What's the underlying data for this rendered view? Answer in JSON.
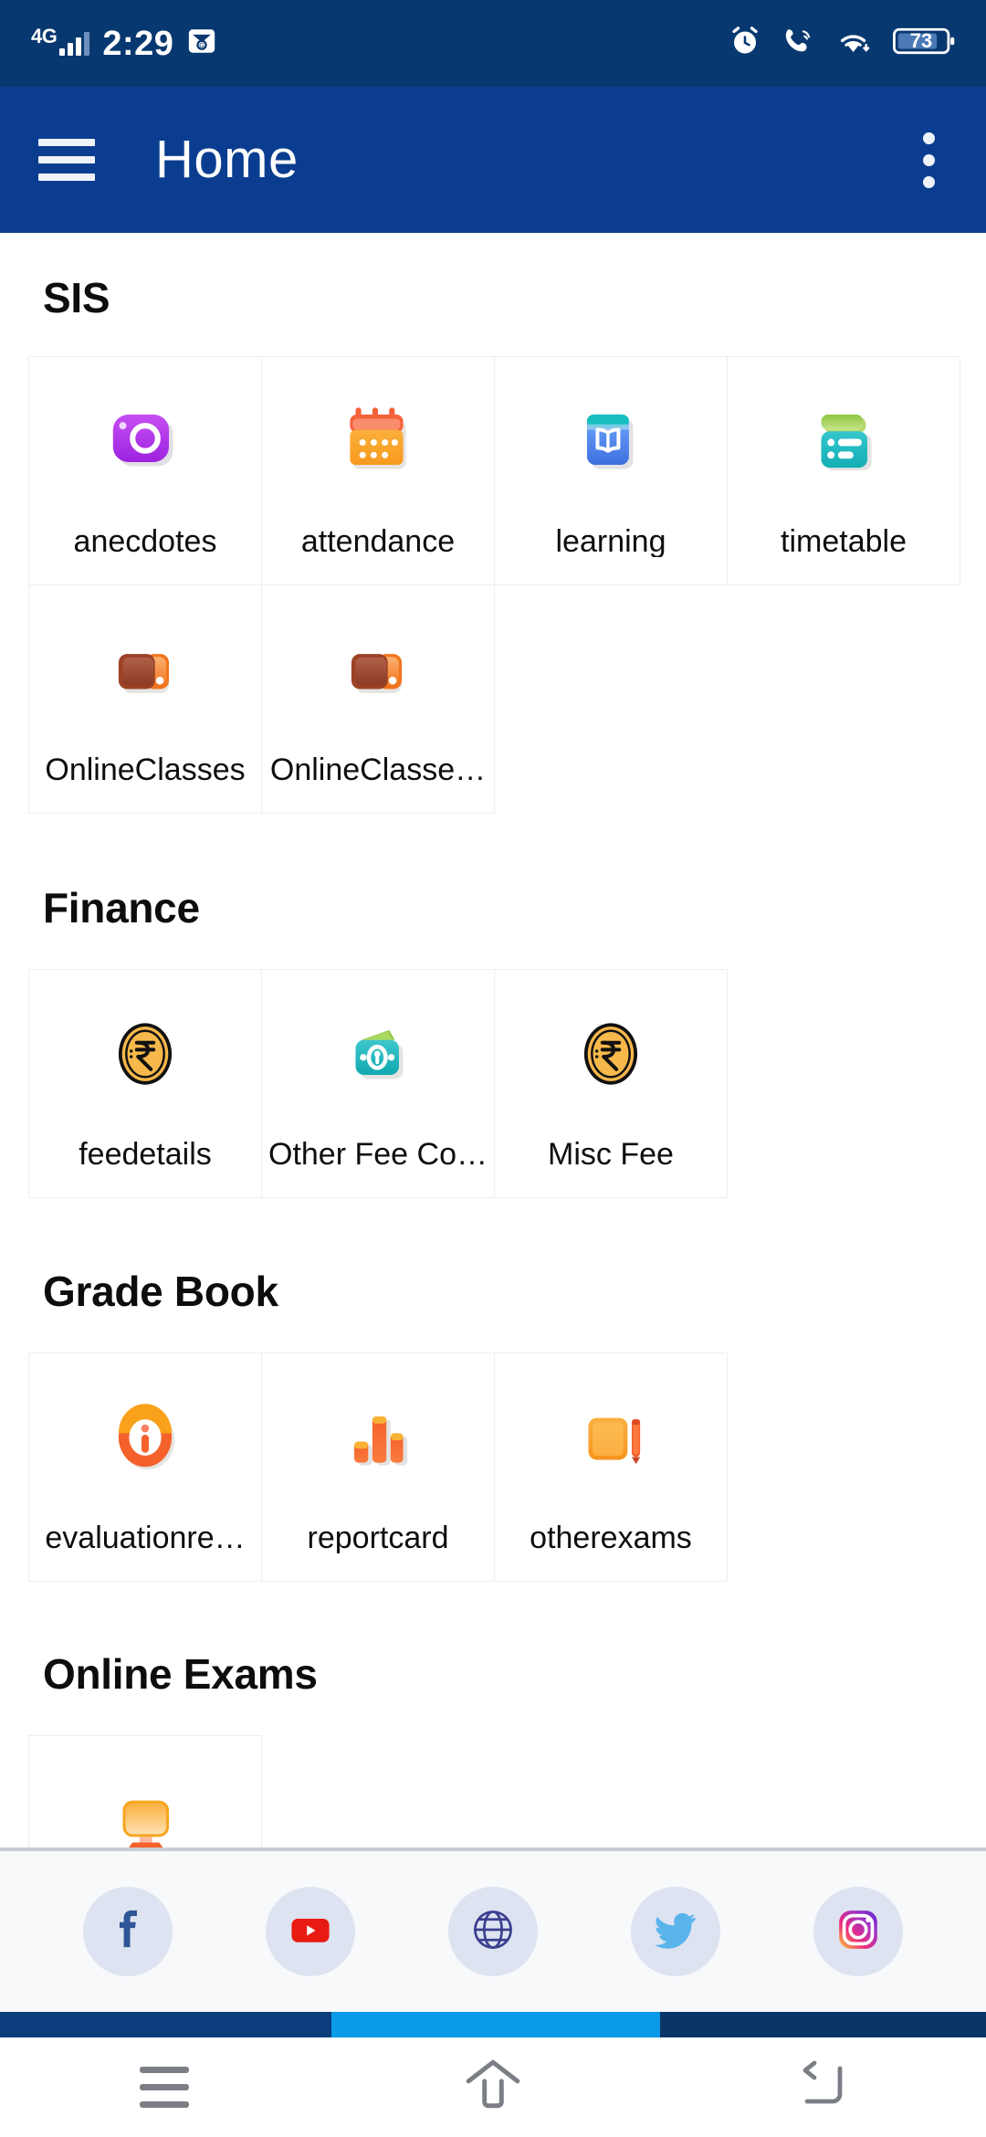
{
  "status_bar": {
    "network": "4G",
    "time": "2:29",
    "mail_icon": "mail-icon",
    "alarm_icon": "alarm-icon",
    "wifi_calling_icon": "wifi-calling-icon",
    "wifi_icon": "wifi-icon",
    "battery_level": "73"
  },
  "app_bar": {
    "menu_icon": "hamburger-menu-icon",
    "title": "Home",
    "overflow_icon": "overflow-menu-icon"
  },
  "sections": [
    {
      "title": "SIS",
      "items": [
        {
          "label": "anecdotes",
          "icon": "camera-icon"
        },
        {
          "label": "attendance",
          "icon": "calendar-icon"
        },
        {
          "label": "learning",
          "icon": "book-icon"
        },
        {
          "label": "timetable",
          "icon": "timetable-icon"
        },
        {
          "label": "OnlineClasses",
          "icon": "online-classes-icon"
        },
        {
          "label": "OnlineClasse…",
          "icon": "online-classes-icon"
        }
      ]
    },
    {
      "title": "Finance",
      "items": [
        {
          "label": "feedetails",
          "icon": "rupee-coin-icon"
        },
        {
          "label": "Other Fee Co…",
          "icon": "wallet-icon"
        },
        {
          "label": "Misc Fee",
          "icon": "rupee-coin-icon"
        }
      ]
    },
    {
      "title": "Grade Book",
      "items": [
        {
          "label": "evaluationre…",
          "icon": "info-circle-icon"
        },
        {
          "label": "reportcard",
          "icon": "bar-chart-icon"
        },
        {
          "label": "otherexams",
          "icon": "notebook-pencil-icon"
        }
      ]
    },
    {
      "title": "Online Exams",
      "items": [
        {
          "label": "",
          "icon": "monitor-icon"
        }
      ]
    }
  ],
  "social_bar": {
    "items": [
      {
        "name": "facebook",
        "icon": "facebook-icon"
      },
      {
        "name": "youtube",
        "icon": "youtube-icon"
      },
      {
        "name": "website",
        "icon": "globe-icon"
      },
      {
        "name": "twitter",
        "icon": "twitter-icon"
      },
      {
        "name": "instagram",
        "icon": "instagram-icon"
      }
    ]
  },
  "nav_bar": {
    "recents_icon": "recents-icon",
    "home_icon": "home-icon",
    "back_icon": "back-icon"
  },
  "colors": {
    "status_bar": "#083870",
    "app_bar": "#0a3d8f",
    "card_border": "#eceef1",
    "social_bg": "#f8f9fb",
    "social_chip": "#dde3f0",
    "accent_blue": "#0b9ae8"
  }
}
